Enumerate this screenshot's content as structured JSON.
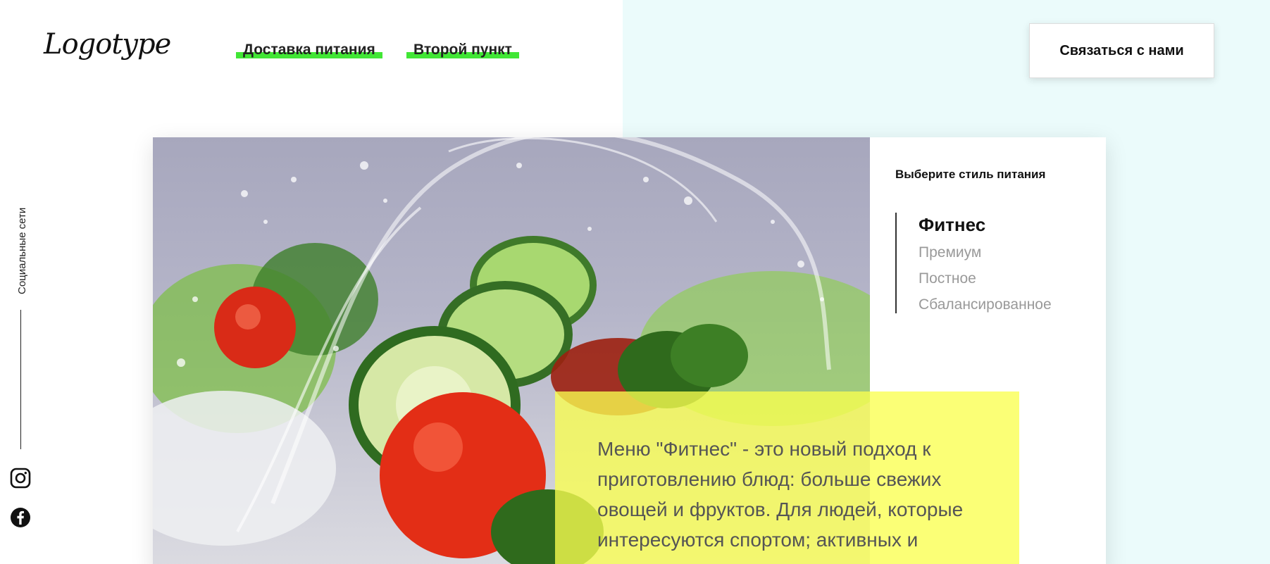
{
  "header": {
    "logo": "Logotype",
    "nav": [
      {
        "label": "Доставка питания"
      },
      {
        "label": "Второй пункт"
      }
    ],
    "contact_button": "Связаться с нами"
  },
  "social": {
    "label": "Социальные сети",
    "icons": [
      "instagram-icon",
      "facebook-icon"
    ]
  },
  "menu_panel": {
    "title": "Выберите стиль питания",
    "styles": [
      {
        "label": "Фитнес",
        "active": true
      },
      {
        "label": "Премиум",
        "active": false
      },
      {
        "label": "Постное",
        "active": false
      },
      {
        "label": "Сбалансированное",
        "active": false
      }
    ]
  },
  "description": "Меню \"Фитнес\" - это новый подход к приготовлению блюд: больше свежих овощей и фруктов. Для людей, которые интересуются спортом; активных и",
  "colors": {
    "accent_green": "#41e635",
    "highlight_yellow": "#faff50",
    "right_background": "#ebfbfb"
  }
}
